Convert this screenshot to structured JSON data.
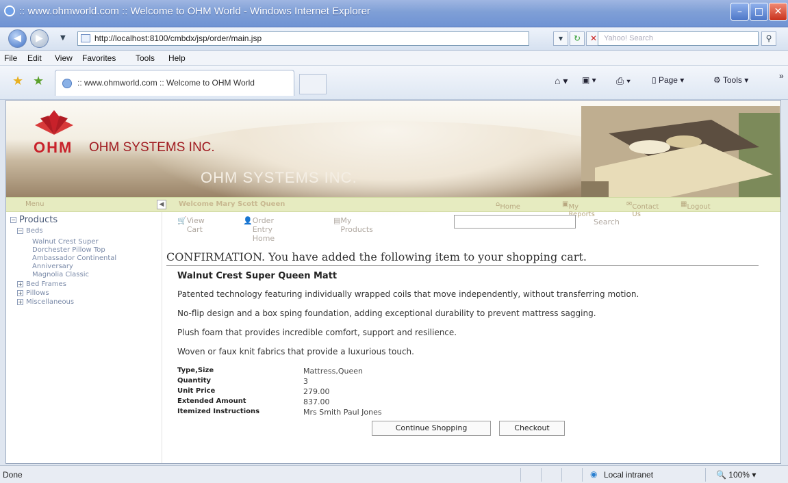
{
  "browser": {
    "window_title": ":: www.ohmworld.com :: Welcome to OHM World - Windows Internet Explorer",
    "address": "http://localhost:8100/cmbdx/jsp/order/main.jsp",
    "search_placeholder": "Yahoo! Search",
    "menu": [
      "File",
      "Edit",
      "View",
      "Favorites",
      "Tools",
      "Help"
    ],
    "tab_title": ":: www.ohmworld.com :: Welcome to OHM World",
    "toolbar": {
      "page_label": "Page",
      "tools_label": "Tools"
    },
    "status": "Done",
    "zone": "Local intranet",
    "zoom": "100%"
  },
  "site": {
    "logo_text": "OHM",
    "company": "OHM SYSTEMS INC.",
    "banner_watermark": "OHM SYSTEMS INC.",
    "menu_label": "Menu",
    "welcome": "Welcome Mary Scott Queen",
    "top_links": {
      "home": "Home",
      "reports": "My Reports",
      "contact": "Contact Us",
      "logout": "Logout"
    },
    "sub_links": {
      "view_cart": "View Cart",
      "order_entry": "Order Entry Home",
      "my_products": "My Products",
      "search": "Search"
    }
  },
  "sidebar": {
    "root": "Products",
    "beds": "Beds",
    "bed_items": [
      "Walnut Crest Super",
      "Dorchester Pillow Top",
      "Ambassador Continental",
      "Anniversary",
      "Magnolia Classic"
    ],
    "categories": [
      "Bed Frames",
      "Pillows",
      "Miscellaneous"
    ]
  },
  "confirmation": {
    "heading": "CONFIRMATION. You have added the following item to your shopping cart.",
    "product": "Walnut Crest Super Queen Matt",
    "descriptions": [
      "Patented technology featuring individually wrapped coils that move independently, without transferring motion.",
      "No-flip design and a box sping foundation, adding exceptional durability to prevent mattress sagging.",
      "Plush foam that provides incredible comfort, support and resilience.",
      "Woven or faux knit fabrics that provide a luxurious touch."
    ],
    "details": [
      {
        "label": "Type,Size",
        "value": "Mattress,Queen"
      },
      {
        "label": "Quantity",
        "value": "3"
      },
      {
        "label": "Unit Price",
        "value": "279.00"
      },
      {
        "label": "Extended Amount",
        "value": "837.00"
      },
      {
        "label": "Itemized Instructions",
        "value": "Mrs Smith Paul Jones"
      }
    ],
    "continue_btn": "Continue Shopping",
    "checkout_btn": "Checkout"
  }
}
